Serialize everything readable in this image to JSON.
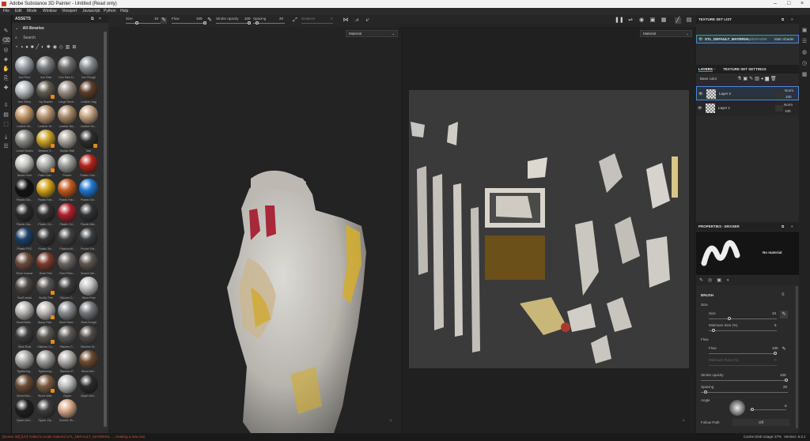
{
  "titlebar": {
    "title": "Adobe Substance 3D Painter - Untitled (Read only)"
  },
  "menu": [
    "File",
    "Edit",
    "Mode",
    "Window",
    "Viewport",
    "Javascript",
    "Python",
    "Help"
  ],
  "toolbar": {
    "size_label": "Size",
    "size_value": "10",
    "flow_label": "Flow",
    "flow_value": "100",
    "opacity_label": "Stroke opacity",
    "opacity_value": "100",
    "spacing_label": "Spacing",
    "spacing_value": "20",
    "distance_label": "Distance",
    "distance_value": "0"
  },
  "assets": {
    "title": "ASSETS",
    "library": "All libraries",
    "search_placeholder": "Search",
    "materials": [
      {
        "label": "Iron Pure",
        "color": "#9aa0a6",
        "badge": false
      },
      {
        "label": "Iron Raw",
        "color": "#7a7c7e",
        "badge": false
      },
      {
        "label": "Iron Raw D...",
        "color": "#6e6c6a",
        "badge": false
      },
      {
        "label": "Iron Rough",
        "color": "#878a8c",
        "badge": false
      },
      {
        "label": "Iron Shiny",
        "color": "#b8bcc0",
        "badge": false
      },
      {
        "label": "Ivy Branch",
        "color": "#5e5a50",
        "badge": true
      },
      {
        "label": "Large Rock...",
        "color": "#9a8d84",
        "badge": false
      },
      {
        "label": "Leather bag",
        "color": "#5a3d29",
        "badge": false
      },
      {
        "label": "Leather Bl...",
        "color": "#c49a6c",
        "badge": false
      },
      {
        "label": "Leather M...",
        "color": "#b89570",
        "badge": false
      },
      {
        "label": "Leather Na...",
        "color": "#a88a68",
        "badge": false
      },
      {
        "label": "Leather Ro...",
        "color": "#c4a280",
        "badge": false
      },
      {
        "label": "Lizard Scales",
        "color": "#8a8a86",
        "badge": false
      },
      {
        "label": "Medium S...",
        "color": "#c9a227",
        "badge": true
      },
      {
        "label": "Mortar Wall",
        "color": "#a9a49a",
        "badge": false
      },
      {
        "label": "Nail",
        "color": "#2c2c2c",
        "badge": true
      },
      {
        "label": "Nickel Pure",
        "color": "#c8c8c4",
        "badge": false
      },
      {
        "label": "Paint Galv...",
        "color": "#b0b0ae",
        "badge": true
      },
      {
        "label": "Pewter",
        "color": "#9c9c98",
        "badge": false
      },
      {
        "label": "Plastic Can...",
        "color": "#b3231c",
        "badge": false
      },
      {
        "label": "Plastic Dia...",
        "color": "#111111",
        "badge": false
      },
      {
        "label": "Plastic Fab...",
        "color": "#d4a216",
        "badge": false
      },
      {
        "label": "Plastic Fab...",
        "color": "#c65a1e",
        "badge": false
      },
      {
        "label": "Plastic Gle...",
        "color": "#1f77d0",
        "badge": false
      },
      {
        "label": "Plastic Gra...",
        "color": "#2a2a2c",
        "badge": false
      },
      {
        "label": "Plastic Gri...",
        "color": "#2e2e30",
        "badge": false
      },
      {
        "label": "Plastic Gri...",
        "color": "#b01e2a",
        "badge": false
      },
      {
        "label": "Plastic Mat...",
        "color": "#2f3134",
        "badge": false
      },
      {
        "label": "Plastic PVC",
        "color": "#1d3f66",
        "badge": false
      },
      {
        "label": "Plastic Str...",
        "color": "#333336",
        "badge": false
      },
      {
        "label": "Plasticsoft...",
        "color": "#404042",
        "badge": false
      },
      {
        "label": "Pocket Pat...",
        "color": "#3a3c3e",
        "badge": false
      },
      {
        "label": "Rock Coarse",
        "color": "#6a4a3c",
        "badge": false
      },
      {
        "label": "Rock Fine",
        "color": "#7b3b2c",
        "badge": false
      },
      {
        "label": "Rust Plain...",
        "color": "#6a6260",
        "badge": false
      },
      {
        "label": "Scarce Me...",
        "color": "#5c5650",
        "badge": false
      },
      {
        "label": "Scuff metal",
        "color": "#4a4846",
        "badge": false
      },
      {
        "label": "Scuffy Thin",
        "color": "#585654",
        "badge": true
      },
      {
        "label": "Silicone C...",
        "color": "#3a3a3c",
        "badge": false
      },
      {
        "label": "Silver Pure",
        "color": "#c0c0c0",
        "badge": false
      },
      {
        "label": "Small Balls...",
        "color": "#b7b5b2",
        "badge": false
      },
      {
        "label": "Spray Pain...",
        "color": "#bcbab6",
        "badge": true
      },
      {
        "label": "Steel Paint...",
        "color": "#8a8c90",
        "badge": false
      },
      {
        "label": "Steel Rough",
        "color": "#76787c",
        "badge": false
      },
      {
        "label": "Steel Rust",
        "color": "#3c3a3a",
        "badge": false
      },
      {
        "label": "Stitches Co...",
        "color": "#5a5650",
        "badge": true
      },
      {
        "label": "Stitches C...",
        "color": "#5c5a58",
        "badge": false
      },
      {
        "label": "Stitches St...",
        "color": "#4e4c4a",
        "badge": false
      },
      {
        "label": "Tightening...",
        "color": "#a8a8a6",
        "badge": false
      },
      {
        "label": "Tightening...",
        "color": "#9c9c9a",
        "badge": false
      },
      {
        "label": "Titanium P...",
        "color": "#b0aea8",
        "badge": false
      },
      {
        "label": "Wood Arti...",
        "color": "#6b4a30",
        "badge": false
      },
      {
        "label": "Wood Bou...",
        "color": "#6a4b35",
        "badge": false
      },
      {
        "label": "Wood Wall...",
        "color": "#7a5a3e",
        "badge": true
      },
      {
        "label": "Zipper",
        "color": "#bcbcbc",
        "badge": false
      },
      {
        "label": "Zipper Ach...",
        "color": "#2a2a2a",
        "badge": false
      },
      {
        "label": "Zipper Ach...",
        "color": "#1e1e1e",
        "badge": false
      },
      {
        "label": "Zipper Zip...",
        "color": "#3c3c3c",
        "badge": false
      },
      {
        "label": "Zombie Sk...",
        "color": "#d9a98a",
        "badge": false
      }
    ]
  },
  "viewport3d": {
    "mode": "Material"
  },
  "viewport2d": {
    "mode": "Material"
  },
  "texture_set_list": {
    "title": "TEXTURE SET LIST",
    "item_name": "STL_DEFAULT_MATERIAL",
    "item_res": "1024×1024",
    "item_shader": "Main shader"
  },
  "layers": {
    "tab_layers": "LAYERS",
    "tab_settings": "TEXTURE SET SETTINGS",
    "blend_mode": "Base color",
    "items": [
      {
        "name": "Layer 2",
        "mode": "Norm",
        "opacity": "100",
        "selected": true
      },
      {
        "name": "Layer 1",
        "mode": "Norm",
        "opacity": "100",
        "selected": false
      }
    ]
  },
  "properties": {
    "title": "PROPERTIES - ERASER",
    "material_label": "No material",
    "brush_title": "BRUSH",
    "size_group": "Size",
    "size_label": "Size",
    "size_value": "10",
    "min_size_label": "Minimum Size (%)",
    "min_size_value": "5",
    "flow_group": "Flow",
    "flow_label": "Flow",
    "flow_value": "100",
    "min_flow_label": "Minimum Flow (%)",
    "min_flow_value": "0",
    "opacity_label": "Stroke opacity",
    "opacity_value": "100",
    "spacing_label": "Spacing",
    "spacing_value": "20",
    "angle_label": "Angle",
    "angle_value": "0",
    "follow_path_label": "Follow Path",
    "follow_path_value": "Off"
  },
  "status": {
    "error": "[Scene 3D] [UV] Failed to scale material STL_DEFAULT_MATERIAL ... creating a new one",
    "cache": "Cache Disk Usage:",
    "cache_value": "27%",
    "version": "Version: 8.3.1"
  }
}
